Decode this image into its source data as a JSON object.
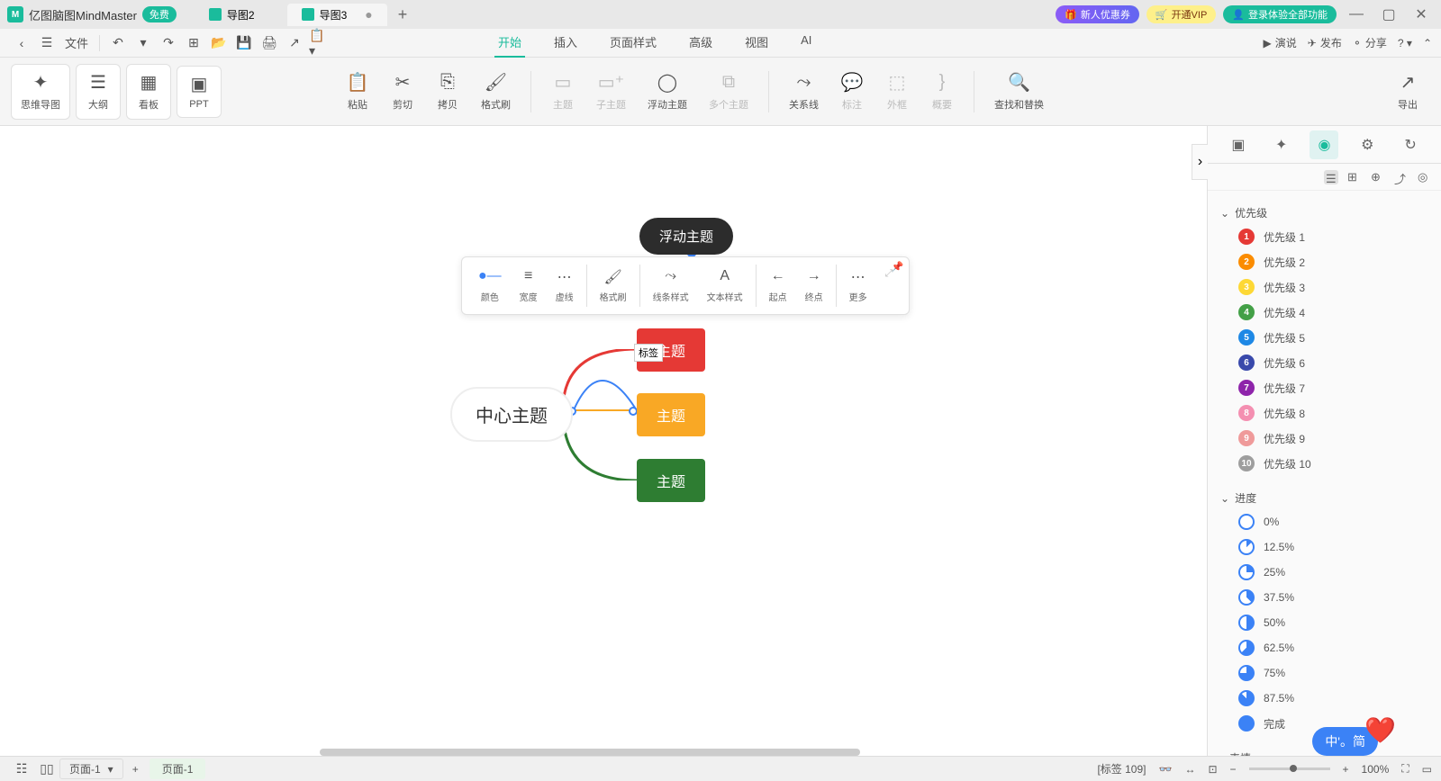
{
  "app": {
    "title": "亿图脑图MindMaster",
    "badge": "免费"
  },
  "tabs": [
    {
      "label": "导图2",
      "active": false
    },
    {
      "label": "导图3",
      "active": true
    }
  ],
  "titlebar_promos": {
    "coupon": "新人优惠券",
    "vip": "开通VIP",
    "login": "登录体验全部功能"
  },
  "menubar": {
    "file": "文件",
    "tabs": [
      "开始",
      "插入",
      "页面样式",
      "高级",
      "视图",
      "AI"
    ],
    "active_tab": "开始",
    "right": {
      "present": "演说",
      "publish": "发布",
      "share": "分享"
    }
  },
  "toolbar": {
    "views": [
      "思维导图",
      "大纲",
      "看板",
      "PPT"
    ],
    "edit": {
      "paste": "粘贴",
      "cut": "剪切",
      "copy": "拷贝",
      "format": "格式刷"
    },
    "topic": {
      "topic": "主题",
      "subtopic": "子主题",
      "floating": "浮动主题",
      "multi": "多个主题"
    },
    "insert": {
      "relation": "关系线",
      "callout": "标注",
      "boundary": "外框",
      "summary": "概要"
    },
    "find": "查找和替换",
    "export": "导出"
  },
  "context_toolbar": {
    "items": [
      "颜色",
      "宽度",
      "虚线",
      "格式刷",
      "线条样式",
      "文本样式",
      "起点",
      "终点",
      "更多"
    ]
  },
  "canvas": {
    "floating_topic": "浮动主题",
    "central_topic": "中心主题",
    "topic1": "主题",
    "topic2": "主题",
    "topic3": "主题",
    "label": "标签"
  },
  "right_panel": {
    "priority_header": "优先级",
    "priorities": [
      {
        "num": "1",
        "label": "优先级 1",
        "color": "#e53935"
      },
      {
        "num": "2",
        "label": "优先级 2",
        "color": "#fb8c00"
      },
      {
        "num": "3",
        "label": "优先级 3",
        "color": "#fdd835"
      },
      {
        "num": "4",
        "label": "优先级 4",
        "color": "#43a047"
      },
      {
        "num": "5",
        "label": "优先级 5",
        "color": "#1e88e5"
      },
      {
        "num": "6",
        "label": "优先级 6",
        "color": "#3949ab"
      },
      {
        "num": "7",
        "label": "优先级 7",
        "color": "#8e24aa"
      },
      {
        "num": "8",
        "label": "优先级 8",
        "color": "#f48fb1"
      },
      {
        "num": "9",
        "label": "优先级 9",
        "color": "#ef9a9a"
      },
      {
        "num": "10",
        "label": "优先级 10",
        "color": "#9e9e9e"
      }
    ],
    "progress_header": "进度",
    "progress": [
      "0%",
      "12.5%",
      "25%",
      "37.5%",
      "50%",
      "62.5%",
      "75%",
      "87.5%",
      "完成"
    ],
    "emoji_header": "表情"
  },
  "statusbar": {
    "page_selector": "页面-1",
    "page_tab": "页面-1",
    "label_info": "[标签 109]",
    "zoom": "100%"
  },
  "ime": "中'。简"
}
